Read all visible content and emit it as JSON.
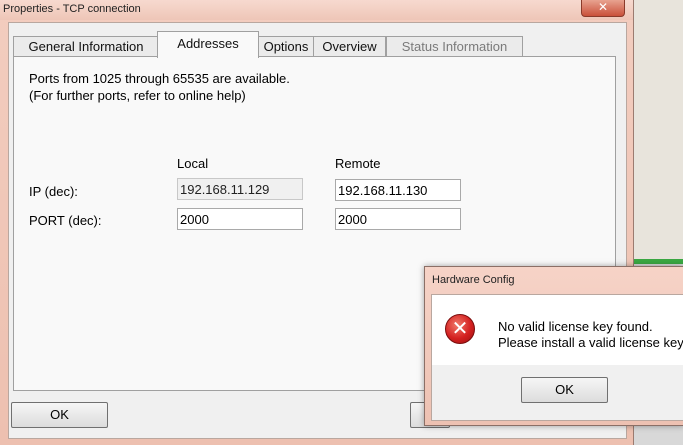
{
  "main_window": {
    "title": "Properties - TCP connection",
    "close_glyph": "✕",
    "tabs": [
      {
        "label": "General Information"
      },
      {
        "label": "Addresses"
      },
      {
        "label": "Options"
      },
      {
        "label": "Overview"
      },
      {
        "label": "Status Information"
      }
    ],
    "active_tab": "Addresses",
    "info_line1": "Ports from 1025 through 65535 are available.",
    "info_line2": "(For further ports, refer to online help)",
    "col_local": "Local",
    "col_remote": "Remote",
    "row_ip_label": "IP (dec):",
    "row_port_label": "PORT (dec):",
    "local_ip": "192.168.11.129",
    "remote_ip": "192.168.11.130",
    "local_port": "2000",
    "remote_port": "2000",
    "ok_label": "OK"
  },
  "message_box": {
    "title": "Hardware Config",
    "icon": "error-icon",
    "icon_glyph": "✕",
    "line1": "No valid license key found.",
    "line2": "Please install a valid license key.",
    "ok_label": "OK"
  },
  "colors": {
    "title_bar": "#f3cdbf",
    "error_red": "#d42020",
    "background_green": "#3aa843"
  }
}
